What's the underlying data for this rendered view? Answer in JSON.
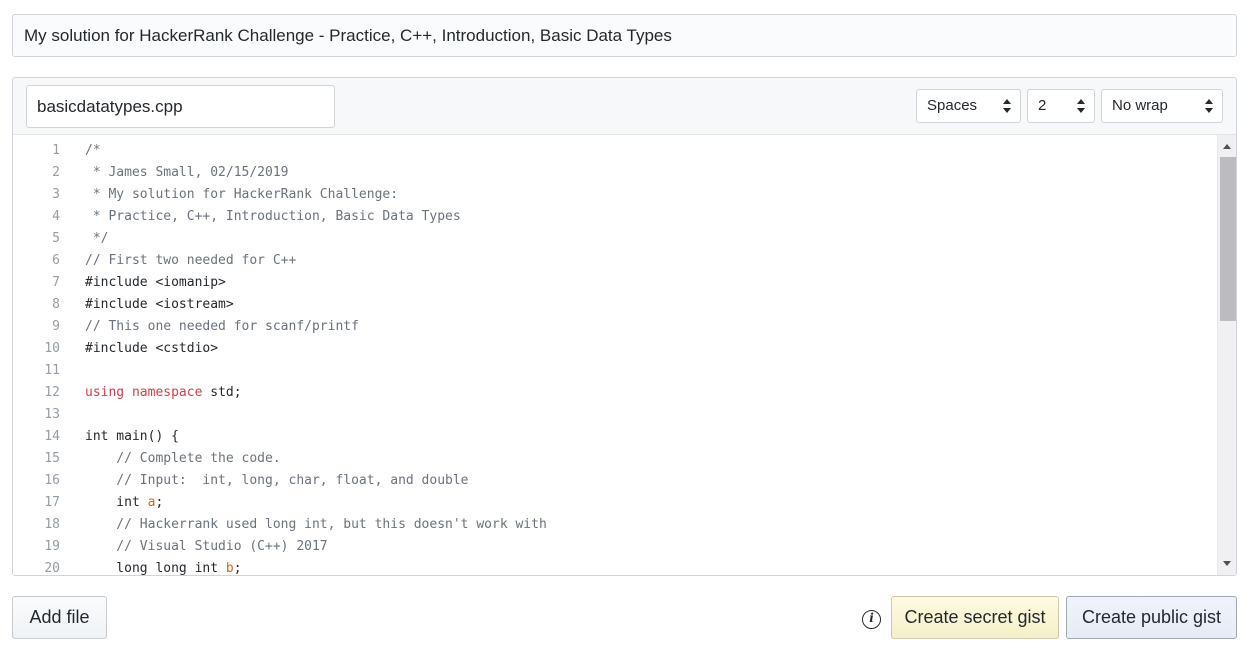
{
  "gist": {
    "description": "My solution for HackerRank Challenge - Practice, C++, Introduction, Basic Data Types",
    "file": {
      "filename": "basicdatatypes.cpp",
      "indent_mode": "Spaces",
      "indent_size": "2",
      "wrap_mode": "No wrap",
      "lines": [
        {
          "n": "1",
          "segments": [
            {
              "t": "/*",
              "c": "comment"
            }
          ]
        },
        {
          "n": "2",
          "segments": [
            {
              "t": " * James Small, 02/15/2019",
              "c": "comment"
            }
          ]
        },
        {
          "n": "3",
          "segments": [
            {
              "t": " * My solution for HackerRank Challenge:",
              "c": "comment"
            }
          ]
        },
        {
          "n": "4",
          "segments": [
            {
              "t": " * Practice, C++, Introduction, Basic Data Types",
              "c": "comment"
            }
          ]
        },
        {
          "n": "5",
          "segments": [
            {
              "t": " */",
              "c": "comment"
            }
          ]
        },
        {
          "n": "6",
          "segments": [
            {
              "t": "// First two needed for C++",
              "c": "comment"
            }
          ]
        },
        {
          "n": "7",
          "segments": [
            {
              "t": "#include <iomanip>",
              "c": ""
            }
          ]
        },
        {
          "n": "8",
          "segments": [
            {
              "t": "#include <iostream>",
              "c": ""
            }
          ]
        },
        {
          "n": "9",
          "segments": [
            {
              "t": "// This one needed for scanf/printf",
              "c": "comment"
            }
          ]
        },
        {
          "n": "10",
          "segments": [
            {
              "t": "#include <cstdio>",
              "c": ""
            }
          ]
        },
        {
          "n": "11",
          "segments": []
        },
        {
          "n": "12",
          "segments": [
            {
              "t": "using",
              "c": "kw"
            },
            {
              "t": " ",
              "c": ""
            },
            {
              "t": "namespace",
              "c": "kw"
            },
            {
              "t": " std;",
              "c": ""
            }
          ]
        },
        {
          "n": "13",
          "segments": []
        },
        {
          "n": "14",
          "segments": [
            {
              "t": "int main() {",
              "c": ""
            }
          ]
        },
        {
          "n": "15",
          "segments": [
            {
              "t": "    // Complete the code.",
              "c": "comment"
            }
          ]
        },
        {
          "n": "16",
          "segments": [
            {
              "t": "    // Input:  int, long, char, float, and double",
              "c": "comment"
            }
          ]
        },
        {
          "n": "17",
          "segments": [
            {
              "t": "    int ",
              "c": ""
            },
            {
              "t": "a",
              "c": "var"
            },
            {
              "t": ";",
              "c": ""
            }
          ]
        },
        {
          "n": "18",
          "segments": [
            {
              "t": "    // Hackerrank used long int, but this doesn't work with",
              "c": "comment"
            }
          ]
        },
        {
          "n": "19",
          "segments": [
            {
              "t": "    // Visual Studio (C++) 2017",
              "c": "comment"
            }
          ]
        },
        {
          "n": "20",
          "segments": [
            {
              "t": "    long long int ",
              "c": ""
            },
            {
              "t": "b",
              "c": "var"
            },
            {
              "t": ";",
              "c": ""
            }
          ]
        }
      ]
    }
  },
  "actions": {
    "add_file": "Add file",
    "create_secret": "Create secret gist",
    "create_public": "Create public gist",
    "info_icon": "info-icon"
  }
}
